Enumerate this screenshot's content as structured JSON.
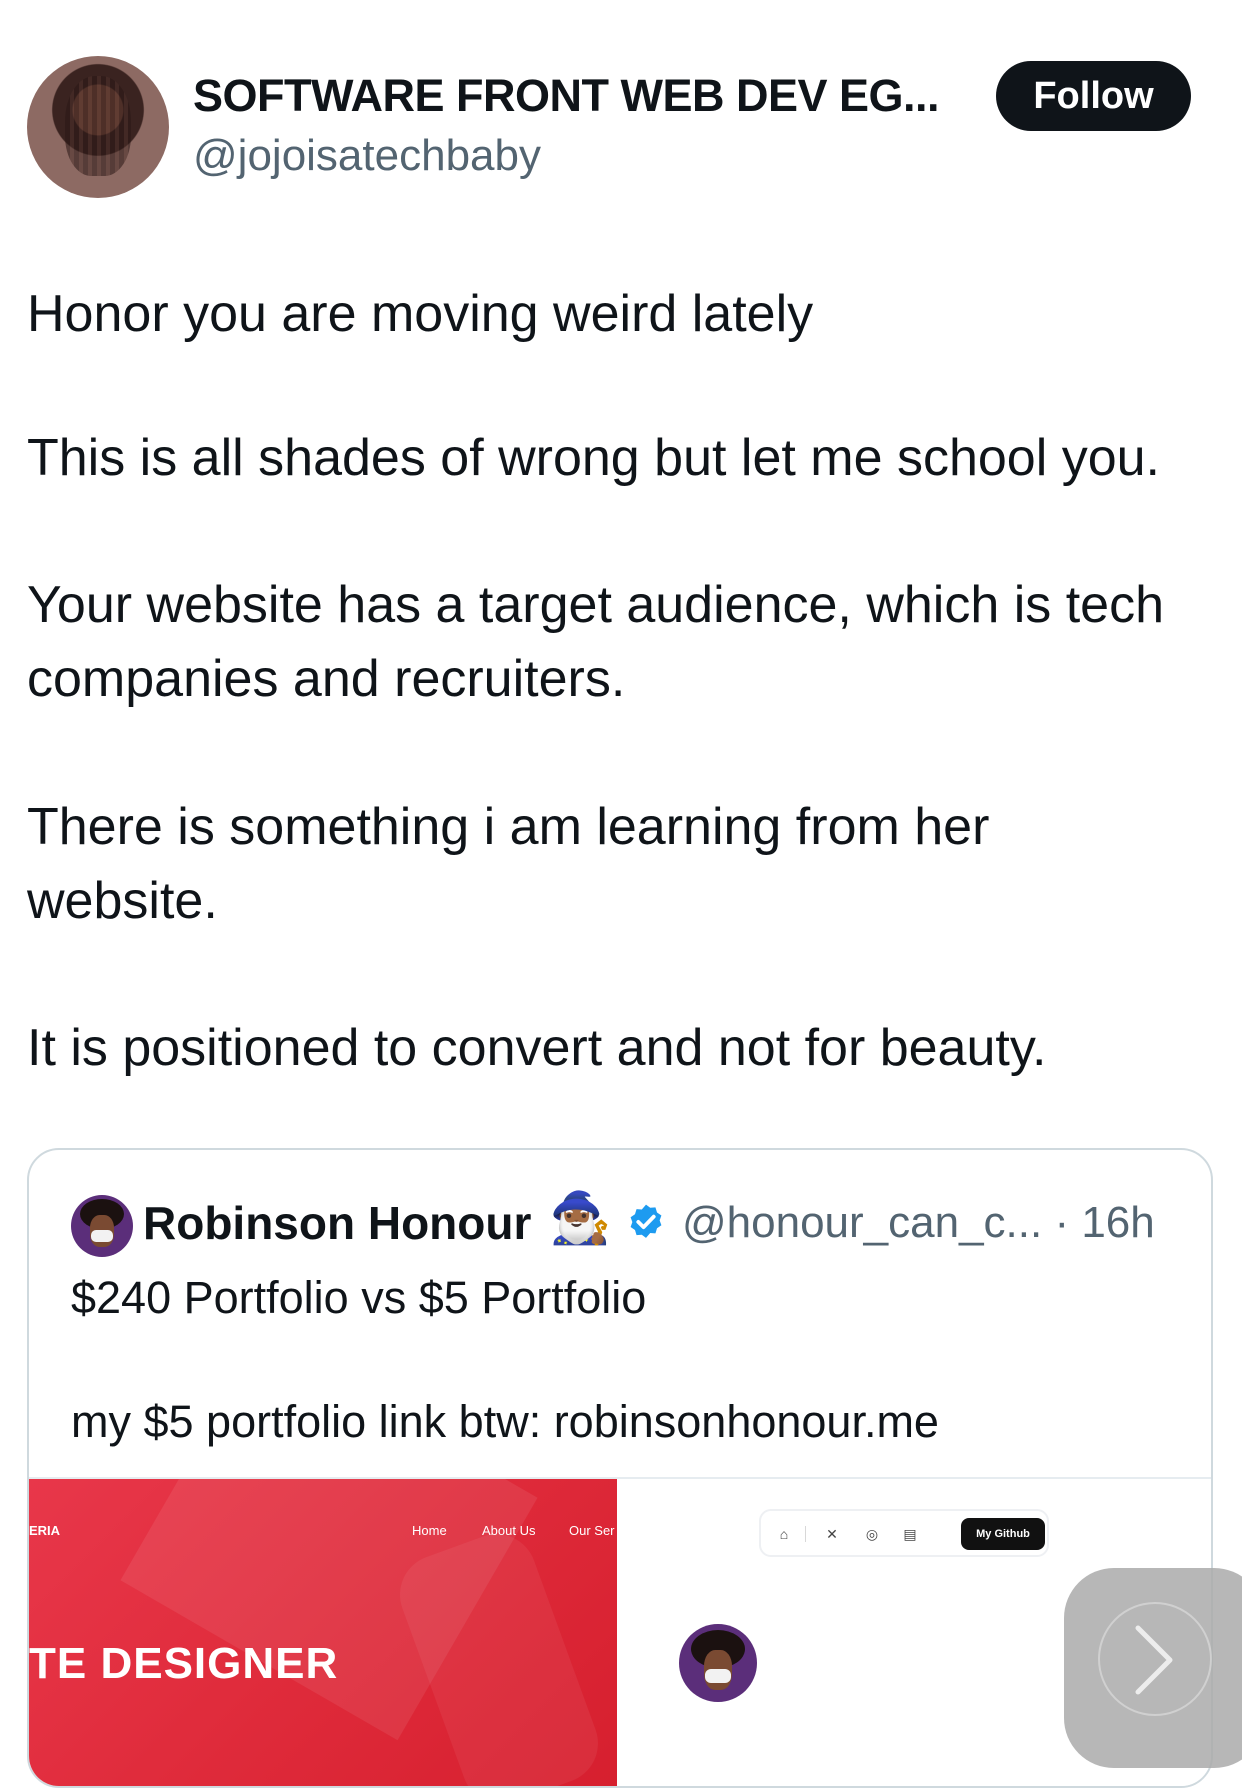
{
  "author": {
    "display_name": "SOFTWARE FRONT WEB DEV EG...",
    "handle": "@jojoisatechbaby",
    "follow_label": "Follow"
  },
  "post": {
    "lines": [
      "Honor you are moving weird lately",
      "This is all shades of wrong but let me school you.",
      "Your website has a target audience, which is tech",
      "companies and recruiters.",
      "There is something i am learning from her",
      "website.",
      "It is positioned to convert and not for beauty."
    ]
  },
  "quote": {
    "name": "Robinson Honour",
    "emoji": "🧙🏾‍♂️",
    "handle_time": "@honour_can_c... · 16h",
    "lines": [
      "$240 Portfolio vs $5 Portfolio",
      "my $5 portfolio link btw: robinsonhonour.me"
    ],
    "media_left": {
      "logo": "ERIA",
      "nav": [
        "Home",
        "About Us",
        "Our Ser"
      ],
      "title": "TE DESIGNER"
    },
    "media_right": {
      "github_label": "My Github",
      "toolbar_icons": [
        "home-icon",
        "x-icon",
        "instagram-icon",
        "document-icon"
      ]
    }
  },
  "colors": {
    "text": "#0f1419",
    "secondary": "#536471",
    "verified": "#1d9bf0",
    "media_red": "#e02c3c"
  }
}
